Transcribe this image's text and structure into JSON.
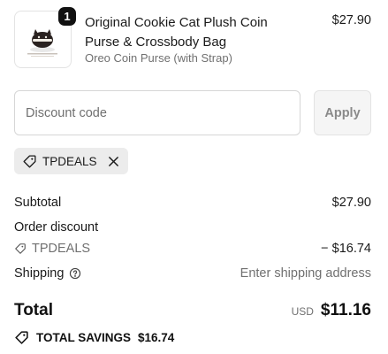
{
  "product": {
    "quantity": "1",
    "title": "Original Cookie Cat Plush Coin Purse & Crossbody Bag",
    "variant": "Oreo Coin Purse (with Strap)",
    "price": "$27.90",
    "thumbnail_icon": "cookie-cat-purse-image"
  },
  "discount": {
    "placeholder": "Discount code",
    "value": "",
    "apply_label": "Apply"
  },
  "applied_code": {
    "code": "TPDEALS",
    "tag_icon": "tag-icon",
    "remove_icon": "close-icon"
  },
  "summary": {
    "subtotal_label": "Subtotal",
    "subtotal_value": "$27.90",
    "order_discount_label": "Order discount",
    "discount_code": "TPDEALS",
    "discount_value": "− $16.74",
    "shipping_label": "Shipping",
    "shipping_help_icon": "help-circle-icon",
    "shipping_value": "Enter shipping address",
    "total_label": "Total",
    "currency": "USD",
    "total_value": "$11.16",
    "savings_label": "TOTAL SAVINGS",
    "savings_value": "$16.74"
  },
  "colors": {
    "text": "#1a1a1a",
    "muted": "#707070",
    "border": "#d6d6d6",
    "chip_bg": "#ececec",
    "badge_bg": "#111111"
  }
}
